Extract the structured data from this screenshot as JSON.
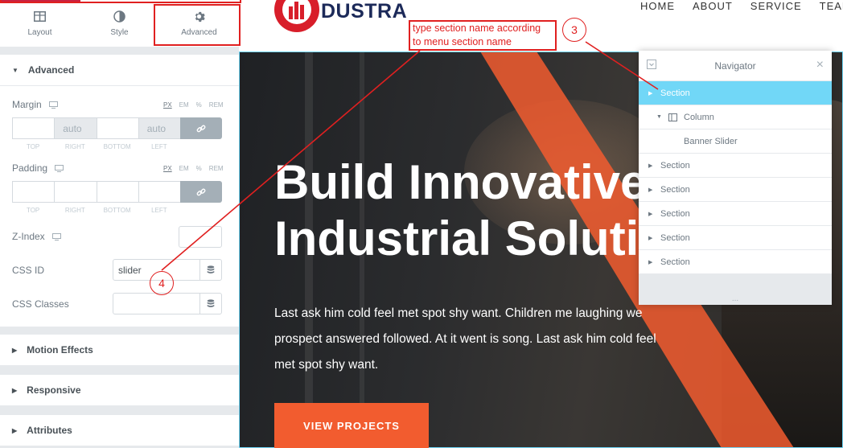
{
  "editor": {
    "tabs": [
      {
        "label": "Layout",
        "icon": "layout-icon"
      },
      {
        "label": "Style",
        "icon": "style-icon"
      },
      {
        "label": "Advanced",
        "icon": "gear-icon"
      }
    ],
    "active_tab": "Advanced",
    "sections": {
      "advanced": "Advanced",
      "motion": "Motion Effects",
      "responsive": "Responsive",
      "attributes": "Attributes"
    },
    "margin": {
      "label": "Margin",
      "units": [
        "PX",
        "EM",
        "%",
        "REM"
      ],
      "values": [
        "",
        "auto",
        "",
        "auto"
      ],
      "dim_labels": [
        "TOP",
        "RIGHT",
        "BOTTOM",
        "LEFT"
      ]
    },
    "padding": {
      "label": "Padding",
      "units": [
        "PX",
        "EM",
        "%",
        "REM"
      ],
      "values": [
        "",
        "",
        "",
        ""
      ],
      "dim_labels": [
        "TOP",
        "RIGHT",
        "BOTTOM",
        "LEFT"
      ]
    },
    "zindex": {
      "label": "Z-Index",
      "value": ""
    },
    "css_id": {
      "label": "CSS ID",
      "value": "slider"
    },
    "css_classes": {
      "label": "CSS Classes",
      "value": ""
    }
  },
  "site": {
    "logo_text": "DUSTRA",
    "menu": [
      "HOME",
      "ABOUT",
      "SERVICE",
      "TEAM"
    ],
    "hero_title_line1": "Build Innovative",
    "hero_title_line2": "Industrial Soluti",
    "hero_text": "Last ask him cold feel met spot shy want. Children me laughing we prospect answered followed. At it went is song. Last ask him cold feel met spot shy want.",
    "hero_button": "VIEW PROJECTS"
  },
  "navigator": {
    "title": "Navigator",
    "items": [
      {
        "label": "Section",
        "level": 0,
        "selected": true
      },
      {
        "label": "Column",
        "level": 1,
        "selected": false
      },
      {
        "label": "Banner Slider",
        "level": 2,
        "selected": false
      },
      {
        "label": "Section",
        "level": 0,
        "selected": false
      },
      {
        "label": "Section",
        "level": 0,
        "selected": false
      },
      {
        "label": "Section",
        "level": 0,
        "selected": false
      },
      {
        "label": "Section",
        "level": 0,
        "selected": false
      },
      {
        "label": "Section",
        "level": 0,
        "selected": false
      }
    ],
    "footer_dots": "..."
  },
  "annotations": {
    "note_line1": "type section name according",
    "note_line2": "to menu section name",
    "step3": "3",
    "step4": "4",
    "color": "#e02020"
  },
  "colors": {
    "accent_blue": "#71d7f7",
    "button_orange": "#f25c2f",
    "logo_red": "#d81e2a",
    "logo_navy": "#1c2a59"
  }
}
